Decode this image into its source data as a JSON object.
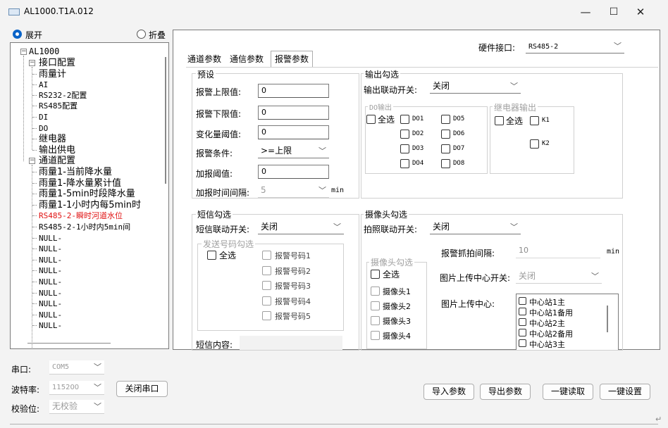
{
  "window": {
    "title": "AL1000.T1A.012",
    "minimize": "—",
    "maximize": "☐",
    "close": "✕"
  },
  "view": {
    "expand": "展开",
    "collapse": "折叠"
  },
  "tree": {
    "root": "AL1000",
    "n1": "接口配置",
    "n1_items": [
      "雨量计",
      "AI",
      "RS232-2配置",
      "RS485配置",
      "DI",
      "DO",
      "继电器",
      "输出供电"
    ],
    "n2": "通道配置",
    "n2_items": [
      "雨量1-当前降水量",
      "雨量1-降水量累计值",
      "雨量1-5min时段降水量",
      "雨量1-1小时内每5min时",
      "RS485-2-瞬时河道水位",
      "RS485-2-1小时内5min间",
      "NULL-",
      "NULL-",
      "NULL-",
      "NULL-",
      "NULL-",
      "NULL-",
      "NULL-",
      "NULL-",
      "NULL-"
    ]
  },
  "hardware": {
    "label": "硬件接口:",
    "value": "RS485-2"
  },
  "tabs": [
    "通道参数",
    "通信参数",
    "报警参数"
  ],
  "preset": {
    "title": "预设",
    "upper_label": "报警上限值:",
    "upper_value": "0",
    "lower_label": "报警下限值:",
    "lower_value": "0",
    "change_label": "变化量阈值:",
    "change_value": "0",
    "cond_label": "报警条件:",
    "cond_value": ">=上限",
    "add_label": "加报阈值:",
    "add_value": "0",
    "interval_label": "加报时间间隔:",
    "interval_value": "5",
    "interval_unit": "min"
  },
  "output": {
    "title": "输出勾选",
    "switch_label": "输出联动开关:",
    "switch_value": "关闭",
    "do_title": "DO输出",
    "do_all": "全选",
    "do_items": [
      "DO1",
      "DO5",
      "DO2",
      "DO6",
      "DO3",
      "DO7",
      "DO4",
      "DO8"
    ],
    "relay_title": "继电器输出",
    "relay_all": "全选",
    "relay_items": [
      "K1",
      "K2"
    ]
  },
  "sms": {
    "title": "短信勾选",
    "switch_label": "短信联动开关:",
    "switch_value": "关闭",
    "numbers_title": "发送号码勾选",
    "all": "全选",
    "numbers": [
      "报警号码1",
      "报警号码2",
      "报警号码3",
      "报警号码4",
      "报警号码5"
    ],
    "content_label": "短信内容:"
  },
  "camera": {
    "title": "摄像头勾选",
    "switch_label": "拍照联动开关:",
    "switch_value": "关闭",
    "interval_label": "报警抓拍间隔:",
    "interval_value": "10",
    "interval_unit": "min",
    "cam_title": "摄像头勾选",
    "all": "全选",
    "cams": [
      "摄像头1",
      "摄像头2",
      "摄像头3",
      "摄像头4"
    ],
    "upload_switch_label": "图片上传中心开关:",
    "upload_switch_value": "关闭",
    "center_label": "图片上传中心:",
    "centers": [
      "中心站1主",
      "中心站1备用",
      "中心站2主",
      "中心站2备用",
      "中心站3主"
    ]
  },
  "serial": {
    "port_label": "串口:",
    "port_value": "COM5",
    "baud_label": "波特率:",
    "baud_value": "115200",
    "parity_label": "校验位:",
    "parity_value": "无校验",
    "close_port": "关闭串口"
  },
  "actions": {
    "import": "导入参数",
    "export": "导出参数",
    "read_all": "一键读取",
    "set_all": "一键设置"
  },
  "colors": {
    "accent": "#0a64c8",
    "alert_text": "#e01010"
  }
}
